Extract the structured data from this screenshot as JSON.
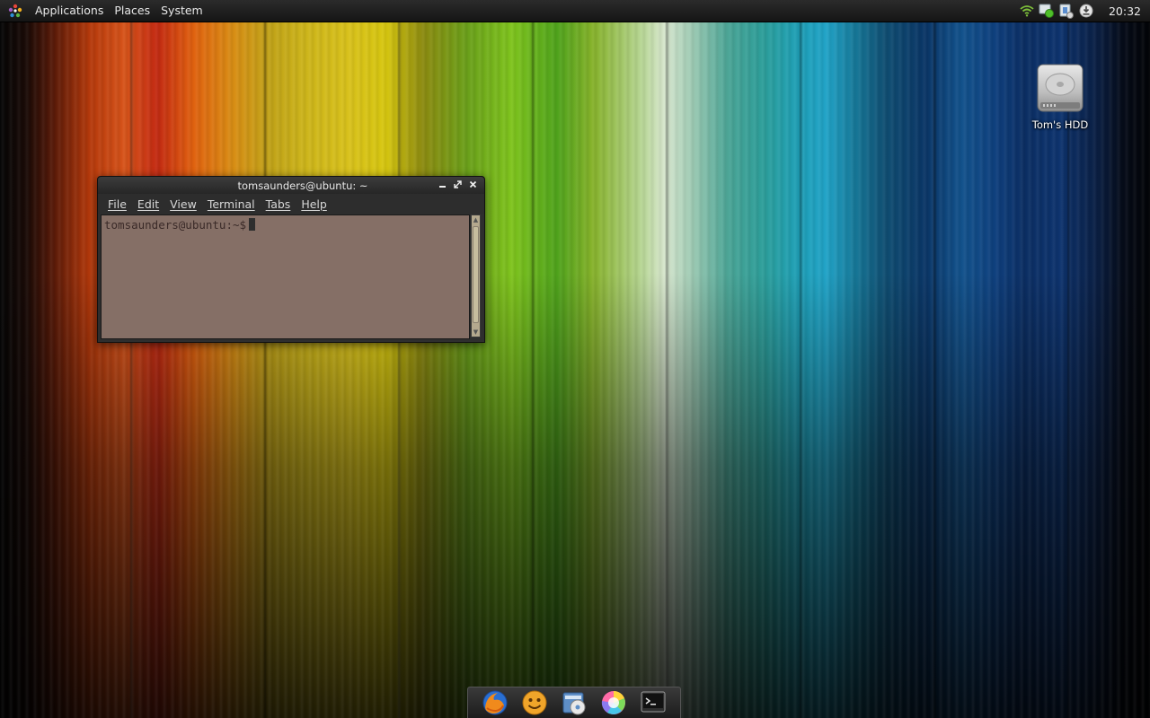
{
  "top_panel": {
    "menus": [
      {
        "label": "Applications"
      },
      {
        "label": "Places"
      },
      {
        "label": "System"
      }
    ],
    "tray_icons": [
      "wifi-icon",
      "network-status-icon",
      "power-icon",
      "updates-icon"
    ],
    "clock": "20:32"
  },
  "desktop": {
    "icons": [
      {
        "label": "Tom's HDD",
        "icon": "hard-drive-icon"
      }
    ]
  },
  "terminal": {
    "title": "tomsaunders@ubuntu: ~",
    "controls": [
      "minimize-icon",
      "maximize-icon",
      "close-icon"
    ],
    "menus": [
      "File",
      "Edit",
      "View",
      "Terminal",
      "Tabs",
      "Help"
    ],
    "prompt": "tomsaunders@ubuntu:~$"
  },
  "dock": {
    "items": [
      {
        "name": "firefox",
        "icon": "firefox-icon"
      },
      {
        "name": "pidgin",
        "icon": "smiley-icon"
      },
      {
        "name": "file-manager",
        "icon": "folder-disc-icon"
      },
      {
        "name": "color-picker",
        "icon": "color-wheel-icon"
      },
      {
        "name": "terminal",
        "icon": "terminal-icon"
      }
    ]
  },
  "colors": {
    "panel": "#1e1e1e",
    "window_frame": "#2e2e2e",
    "terminal_bg": "#cda596"
  }
}
